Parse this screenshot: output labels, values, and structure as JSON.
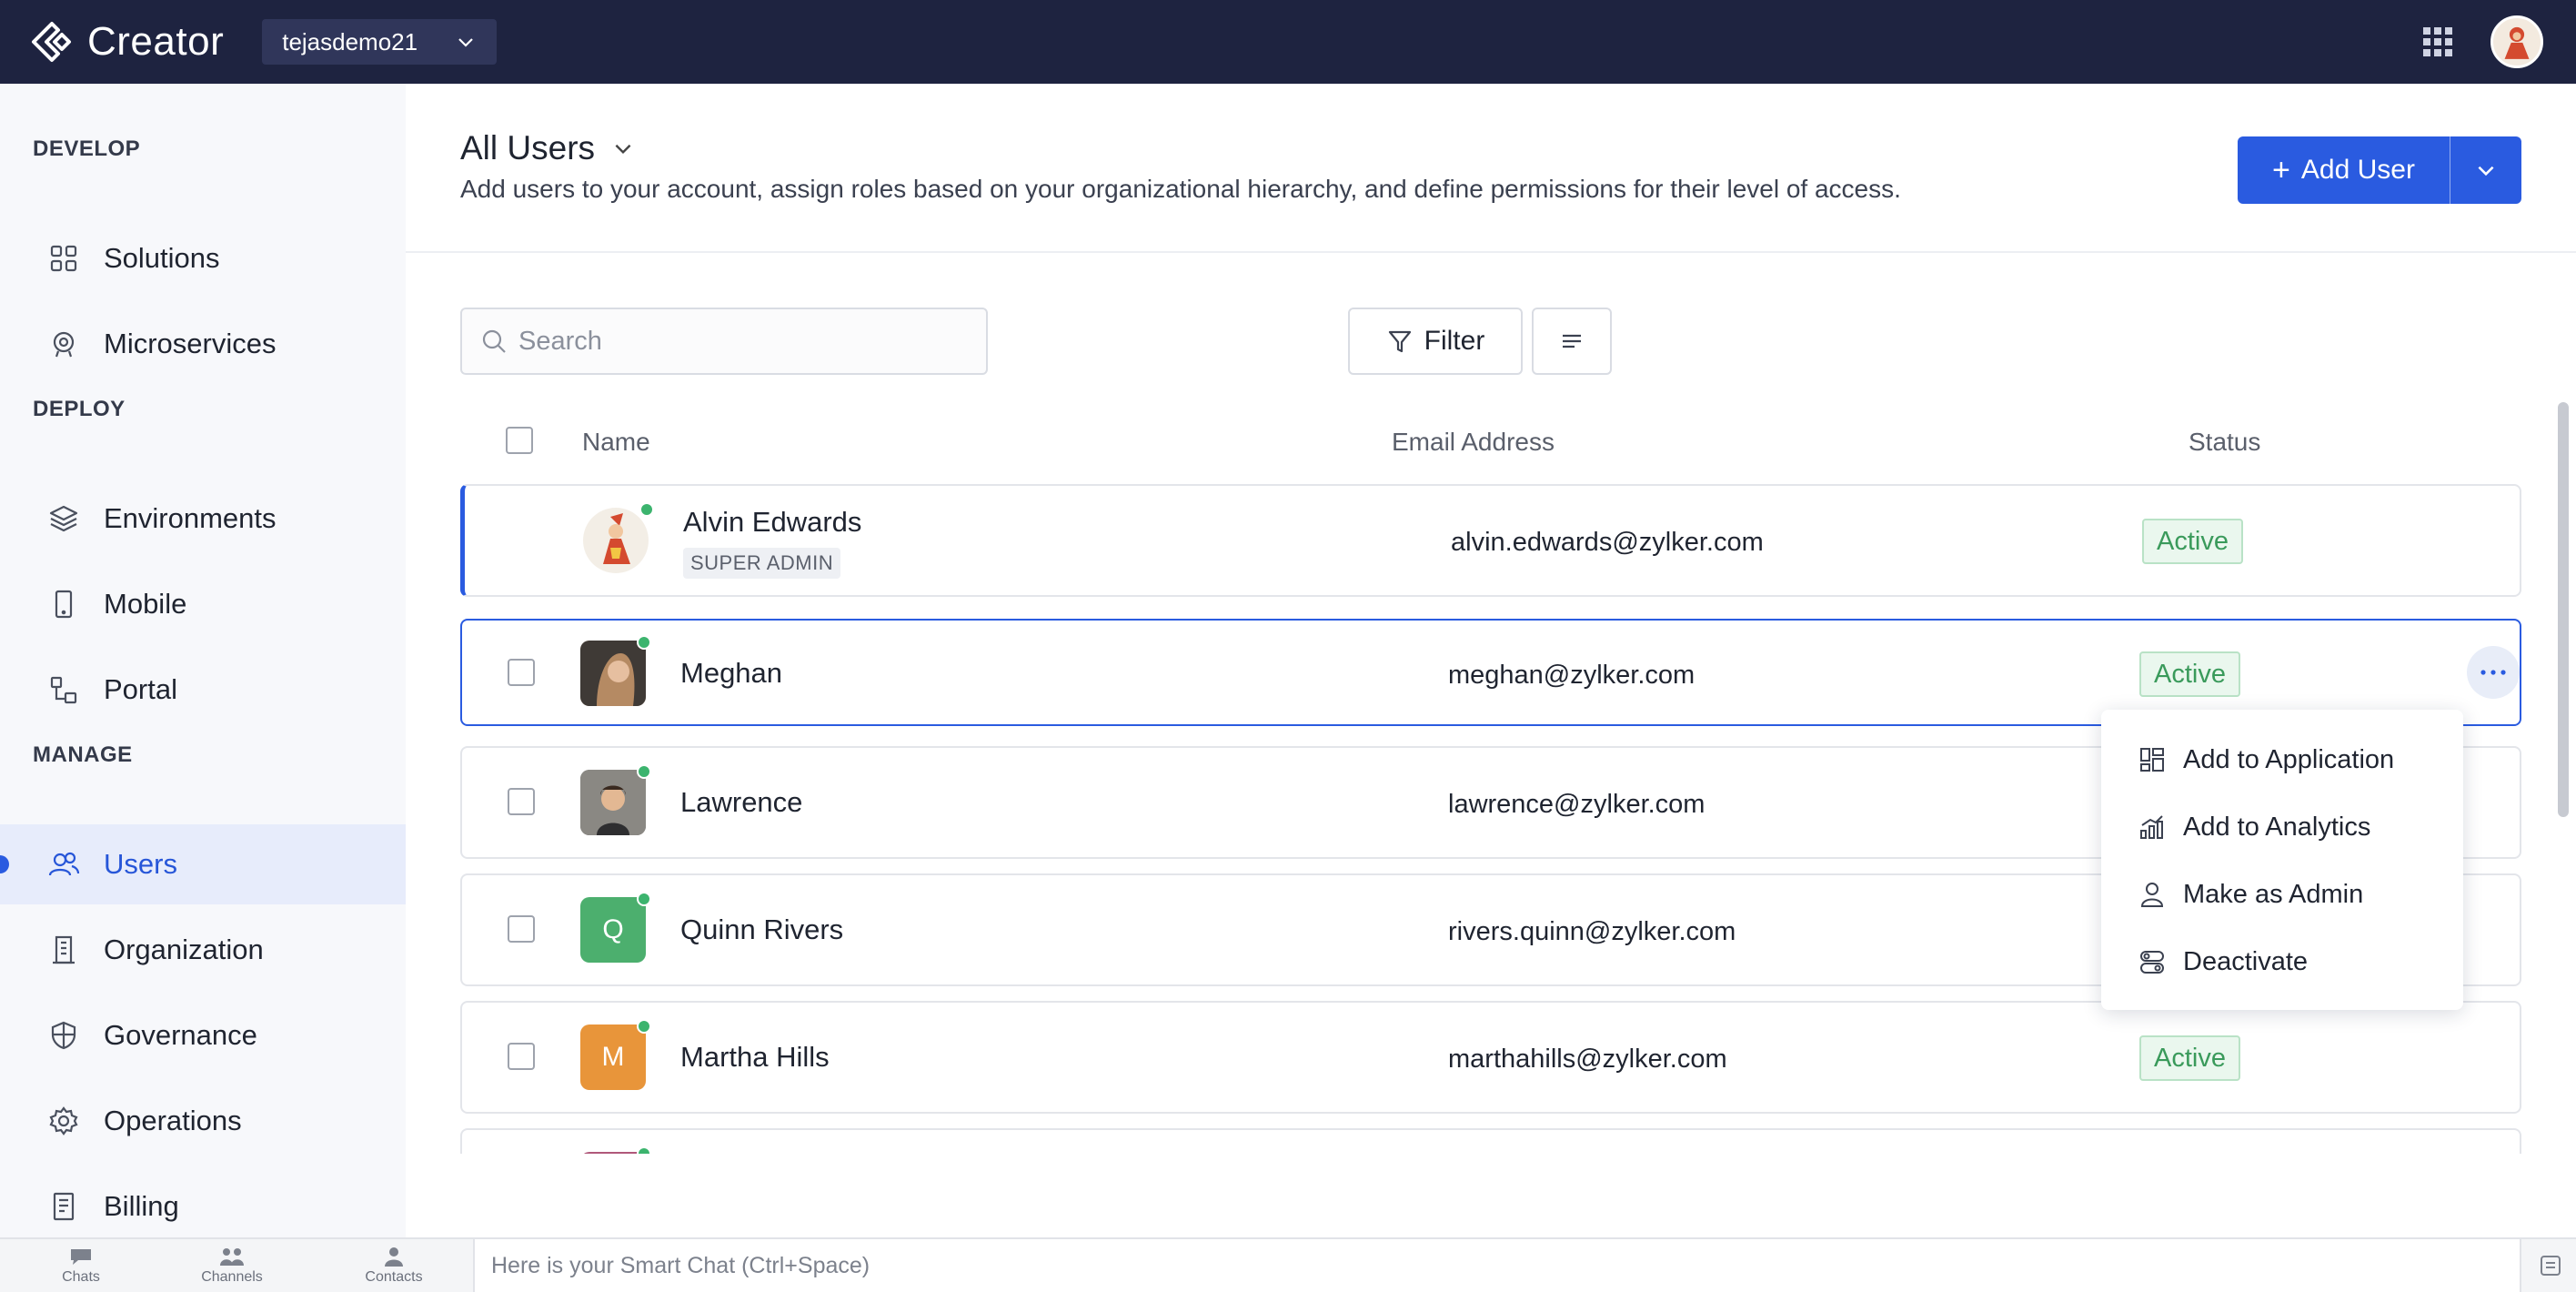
{
  "app": {
    "name": "Creator",
    "org": "tejasdemo21"
  },
  "sidebar": {
    "sections": [
      {
        "label": "DEVELOP"
      },
      {
        "label": "DEPLOY"
      },
      {
        "label": "MANAGE"
      }
    ],
    "items": [
      {
        "label": "Solutions",
        "icon": "grid-icon"
      },
      {
        "label": "Microservices",
        "icon": "microservice-icon"
      },
      {
        "label": "Environments",
        "icon": "layers-icon"
      },
      {
        "label": "Mobile",
        "icon": "mobile-icon"
      },
      {
        "label": "Portal",
        "icon": "portal-icon"
      },
      {
        "label": "Users",
        "icon": "users-icon",
        "active": true
      },
      {
        "label": "Organization",
        "icon": "building-icon"
      },
      {
        "label": "Governance",
        "icon": "shield-icon"
      },
      {
        "label": "Operations",
        "icon": "gear-icon"
      },
      {
        "label": "Billing",
        "icon": "receipt-icon"
      }
    ]
  },
  "header": {
    "title": "All Users",
    "description": "Add users to your account, assign roles based on your organizational hierarchy, and define permissions for their level of access.",
    "add_user_label": "Add User"
  },
  "toolbar": {
    "search_placeholder": "Search",
    "filter_label": "Filter"
  },
  "table": {
    "columns": [
      "Name",
      "Email Address",
      "Status"
    ],
    "rows": [
      {
        "name": "Alvin Edwards",
        "role": "SUPER ADMIN",
        "email": "alvin.edwards@zylker.com",
        "status": "Active"
      },
      {
        "name": "Meghan",
        "email": "meghan@zylker.com",
        "status": "Active"
      },
      {
        "name": "Lawrence",
        "email": "lawrence@zylker.com",
        "status": ""
      },
      {
        "name": "Quinn Rivers",
        "initial": "Q",
        "avatar_color": "#4caf6e",
        "email": "rivers.quinn@zylker.com",
        "status": ""
      },
      {
        "name": "Martha Hills",
        "initial": "M",
        "avatar_color": "#e8953a",
        "email": "marthahills@zylker.com",
        "status": "Active"
      }
    ]
  },
  "row_menu": {
    "items": [
      {
        "label": "Add to Application",
        "icon": "application-icon"
      },
      {
        "label": "Add to Analytics",
        "icon": "analytics-icon"
      },
      {
        "label": "Make as Admin",
        "icon": "person-icon"
      },
      {
        "label": "Deactivate",
        "icon": "deactivate-icon"
      }
    ]
  },
  "bottom_bar": {
    "tabs": [
      "Chats",
      "Channels",
      "Contacts"
    ],
    "chat_placeholder": "Here is your Smart Chat (Ctrl+Space)"
  },
  "colors": {
    "topbar": "#1e2340",
    "accent": "#2a5be0",
    "active_status": "#3a9a5b"
  }
}
